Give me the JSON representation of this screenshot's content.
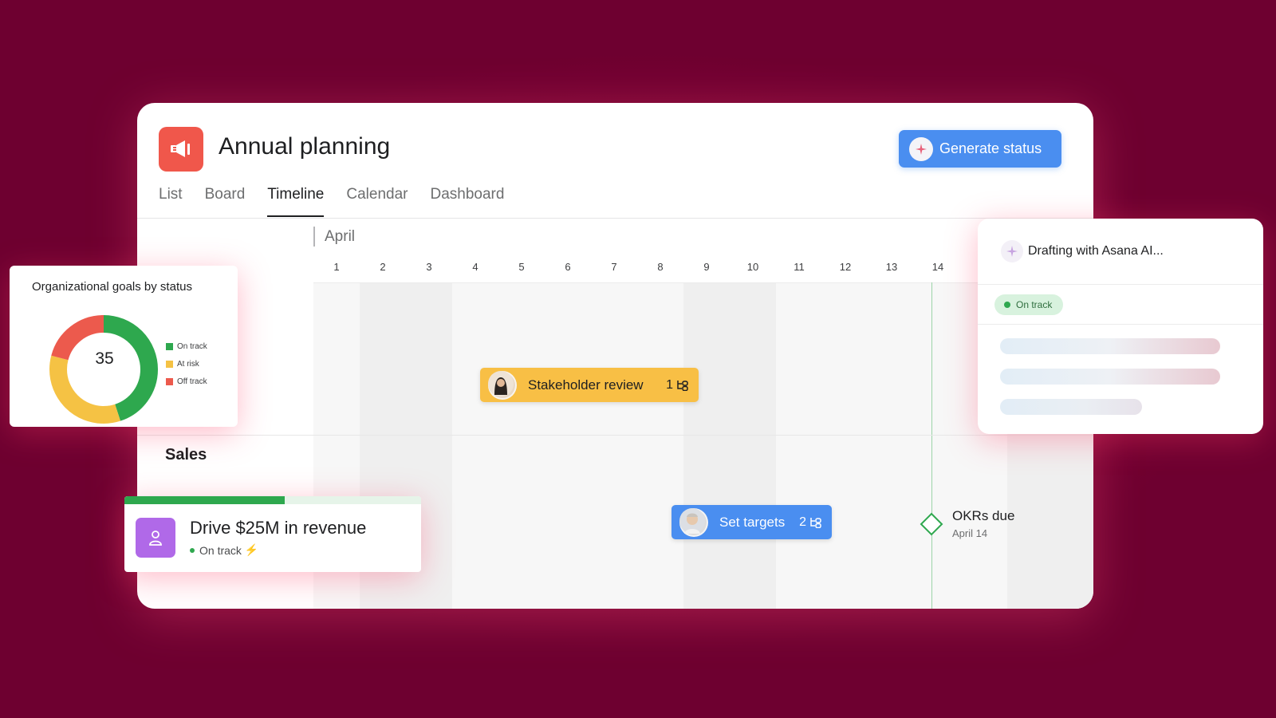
{
  "app": {
    "title": "Annual planning",
    "generate_button": "Generate status",
    "project_icon": "megaphone-icon",
    "colors": {
      "background": "#6e0030",
      "accent": "#4a8ef0",
      "project": "#f0574b"
    }
  },
  "tabs": [
    {
      "label": "List",
      "active": false
    },
    {
      "label": "Board",
      "active": false
    },
    {
      "label": "Timeline",
      "active": true
    },
    {
      "label": "Calendar",
      "active": false
    },
    {
      "label": "Dashboard",
      "active": false
    }
  ],
  "timeline": {
    "month": "April",
    "days": [
      "1",
      "2",
      "3",
      "4",
      "5",
      "6",
      "7",
      "8",
      "9",
      "10",
      "11",
      "12",
      "13",
      "14",
      "1"
    ],
    "today": "14",
    "sections": [
      {
        "label": "Sales"
      }
    ],
    "tasks": [
      {
        "name": "Stakeholder review",
        "subtasks": "1",
        "color": "#f8bf45"
      },
      {
        "name": "Set targets",
        "subtasks": "2",
        "color": "#4a8ef0"
      }
    ],
    "milestone": {
      "title": "OKRs due",
      "date": "April 14"
    }
  },
  "goals_card": {
    "title": "Organizational goals by status",
    "total": "35",
    "legend": [
      {
        "label": "On track",
        "color": "#2ea84e"
      },
      {
        "label": "At risk",
        "color": "#f5c244"
      },
      {
        "label": "Off track",
        "color": "#ec5a4d"
      }
    ]
  },
  "ai_card": {
    "title": "Drafting with Asana AI...",
    "status": "On track"
  },
  "goal_card": {
    "title": "Drive $25M in revenue",
    "status": "On track",
    "progress": 0.54
  }
}
